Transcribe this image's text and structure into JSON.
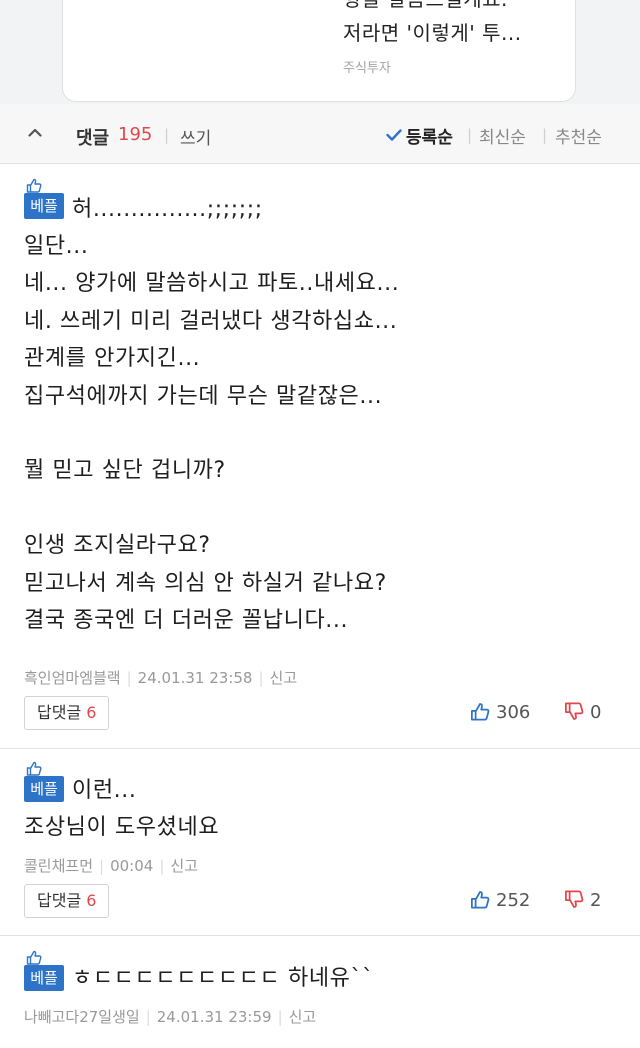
{
  "article_card": {
    "line1": "향을 말씀드릴게요.",
    "line2": "저라면 '이렇게' 투...",
    "source": "주식투자"
  },
  "comments_header": {
    "title": "댓글",
    "count": "195",
    "write_label": "쓰기",
    "sort_options": [
      "등록순",
      "최신순",
      "추천순"
    ],
    "active_sort": "등록순",
    "accent_color": "#e0474c",
    "check_color": "#2d74c9"
  },
  "comments": [
    {
      "badge": "베플",
      "text": "허...............;;;;;;;\n일단...\n네... 양가에 말씀하시고 파토..내세요...\n네. 쓰레기 미리 걸러냈다 생각하십쇼...\n관계를 안가지긴...\n집구석에까지 가는데 무슨 말같잖은...\n\n뭘 믿고 싶단 겁니까?\n\n인생 조지실라구요?\n믿고나서 계속 의심 안 하실거 같나요?\n결국 종국엔 더 더러운 꼴납니다...",
      "author": "흑인엄마엠블랙",
      "timestamp": "24.01.31  23:58",
      "report_label": "신고",
      "reply_label": "답댓글",
      "reply_count": "6",
      "likes": "306",
      "dislikes": "0"
    },
    {
      "badge": "베플",
      "text": "이런...\n조상님이 도우셨네요",
      "author": "콜린채프먼",
      "timestamp": "00:04",
      "report_label": "신고",
      "reply_label": "답댓글",
      "reply_count": "6",
      "likes": "252",
      "dislikes": "2"
    },
    {
      "badge": "베플",
      "text": "ㅎㄷㄷㄷㄷㄷㄷㄷㄷㄷ 하네유``",
      "author": "나빼고다27일생일",
      "timestamp": "24.01.31  23:59",
      "report_label": "신고"
    }
  ],
  "icons": {
    "best_badge": "thumbs-up-icon",
    "collapse": "chevron-up-icon",
    "sort_active": "checkmark-icon",
    "like": "thumbs-up-icon",
    "dislike": "thumbs-down-icon"
  },
  "colors": {
    "badge_blue": "#2d74c9",
    "dislike_red": "#e0474c",
    "header_bg": "#f7f7f8"
  }
}
